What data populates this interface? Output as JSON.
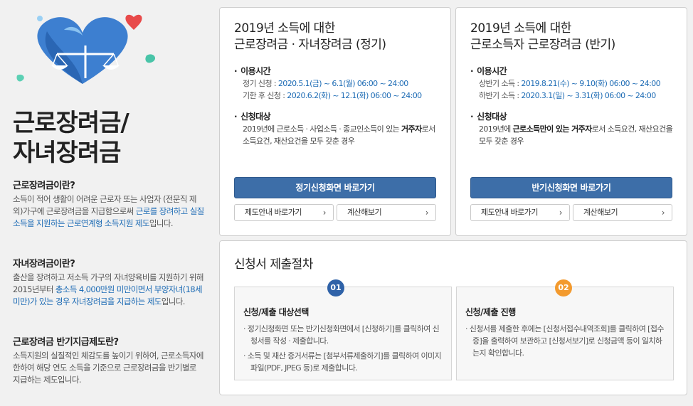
{
  "left": {
    "title_line1": "근로장려금/",
    "title_line2": "자녀장려금",
    "sections": [
      {
        "heading": "근로장려금이란?",
        "text_plain": "소득이 적어 생활이 어려운 근로자 또는 사업자 (전문직 제외)가구에 근로장려금을 지급함으로써 ",
        "text_hl": "근로를 장려하고 실질소득을 지원하는 근로연계형 소득지원 제도",
        "text_end": "입니다."
      },
      {
        "heading": "자녀장려금이란?",
        "text_plain": "출산을 장려하고 저소득 가구의 자녀양육비를 지원하기 위해 2015년부터 ",
        "text_hl": "총소득 4,000만원 미만이면서 부양자녀(18세 미만)가 있는 경우 자녀장려금을 지급하는 제도",
        "text_end": "입니다."
      },
      {
        "heading": "근로장려금 반기지급제도란?",
        "text_plain": "소득지원의 실질적인 체감도를 높이기 위하여, 근로소득자에 한하여 해당 연도 소득을 기준으로 근로장려금을 반기별로 지급하는 제도입니다.",
        "text_hl": "",
        "text_end": ""
      }
    ]
  },
  "card_regular": {
    "title_line1": "2019년 소득에 대한",
    "title_line2": "근로장려금 · 자녀장려금 (정기)",
    "usage_heading": "이용시간",
    "usage_rows": [
      {
        "label": "정기 신청 : ",
        "value": "2020.5.1(금) ~ 6.1(월) 06:00 ~ 24:00"
      },
      {
        "label": "기한 후 신청 : ",
        "value": "2020.6.2(화) ~ 12.1(화) 06:00 ~ 24:00"
      }
    ],
    "target_heading": "신청대상",
    "target_plain": "2019년에 근로소득 · 사업소득 · 종교인소득이 있는 ",
    "target_bold": "거주자",
    "target_end": "로서 소득요건, 재산요건을 모두 갖춘 경우",
    "main_button": "정기신청화면 바로가기",
    "btn_guide": "제도안내 바로가기",
    "btn_calc": "계산해보기"
  },
  "card_half": {
    "title_line1": "2019년 소득에 대한",
    "title_line2": "근로소득자 근로장려금 (반기)",
    "usage_heading": "이용시간",
    "usage_rows": [
      {
        "label": "상반기 소득 : ",
        "value": "2019.8.21(수) ~ 9.10(화) 06:00 ~ 24:00"
      },
      {
        "label": "하반기 소득 : ",
        "value": "2020.3.1(일) ~ 3.31(화) 06:00 ~ 24:00"
      }
    ],
    "target_heading": "신청대상",
    "target_plain": "2019년에 ",
    "target_bold": "근로소득만이 있는 거주자",
    "target_end": "로서 소득요건, 재산요건을 모두 갖춘 경우",
    "main_button": "반기신청화면 바로가기",
    "btn_guide": "제도안내 바로가기",
    "btn_calc": "계산해보기"
  },
  "procedure": {
    "title": "신청서 제출절차",
    "steps": [
      {
        "num": "01",
        "color": "#2f62a8",
        "heading": "신청/제출 대상선택",
        "items": [
          "정기신청화면 또는 반기신청화면에서 [신청하기]를 클릭하여 신청서를 작성 · 제출합니다.",
          "소득 및 재산 증거서류는 [첨부서류제출하기]를 클릭하여 이미지파일(PDF, JPEG 등)로 제출합니다."
        ]
      },
      {
        "num": "02",
        "color": "#f39a2e",
        "heading": "신청/제출 진행",
        "items": [
          "신청서를 제출한 후에는 [신청서접수내역조회]를 클릭하여 [접수증]을 출력하여 보관하고 [신청서보기]로 신청금액 등이 일치하는지 확인합니다."
        ]
      }
    ]
  },
  "icons": {
    "chevron": "chevron-right-icon",
    "hero": "heart-scale-illustration"
  }
}
